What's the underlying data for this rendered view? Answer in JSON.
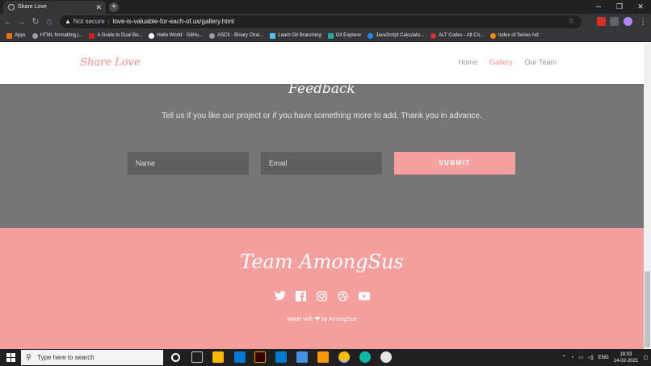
{
  "browser": {
    "tab_title": "Share Love",
    "tab_close": "✕",
    "new_tab": "+",
    "security_label": "Not secure",
    "url": "love-is-valuable-for-each-of.us/gallery.html",
    "bookmarks": [
      "Apps",
      "HTML formatting |...",
      "A Guide to Dual Bo...",
      "Hello World · GitHu...",
      "ASCII - Binary Char...",
      "Learn Git Branching",
      "Git Explorer",
      "JavaScript Calculato...",
      "ALT Codes - Alt Co...",
      "Index of Series /vd"
    ]
  },
  "site": {
    "brand": "Share Love",
    "nav": [
      "Home",
      "Gallery",
      "Our Team"
    ],
    "active_nav": "Gallery",
    "feedback": {
      "title": "Feedback",
      "text": "Tell us if you like our project or if you have something more to add. Thank you in advance.",
      "name_placeholder": "Name",
      "email_placeholder": "Email",
      "submit_label": "SUBMIT"
    },
    "footer": {
      "team_name": "Team AmongSus",
      "social_icons": [
        "twitter-icon",
        "facebook-icon",
        "instagram-icon",
        "dribbble-icon",
        "youtube-icon"
      ],
      "made_with_prefix": "Made with",
      "made_with_suffix": "by AmongSus"
    }
  },
  "taskbar": {
    "search_placeholder": "Type here to search",
    "language": "ENG",
    "time": "18:03",
    "date": "14-02-2021"
  },
  "colors": {
    "accent_pink": "#f4a09e",
    "feedback_bg": "#767676",
    "brand_text": "#ef8b88"
  }
}
